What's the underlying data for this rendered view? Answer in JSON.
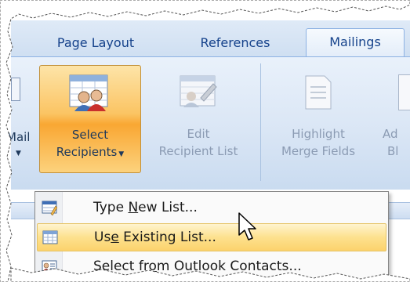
{
  "tabs": {
    "page_layout": "Page Layout",
    "references": "References",
    "mailings": "Mailings"
  },
  "ribbon": {
    "mail_fragment": "Mail",
    "select_line1": "Select",
    "select_line2": "Recipients",
    "edit_line1": "Edit",
    "edit_line2": "Recipient List",
    "highlight_line1": "Highlight",
    "highlight_line2": "Merge Fields",
    "address_line1": "Ad",
    "address_line2": "Bl"
  },
  "menu": {
    "items": [
      {
        "pre": "Type ",
        "key": "N",
        "post": "ew List..."
      },
      {
        "pre": "Us",
        "key": "e",
        "post": " Existing List..."
      },
      {
        "pre": "Select fr",
        "key": "o",
        "post": "m Outlook Contacts..."
      }
    ]
  },
  "colors": {
    "accent_selected": "#fbc463",
    "menu_hot": "#fde18e",
    "tab_text": "#15428b"
  }
}
